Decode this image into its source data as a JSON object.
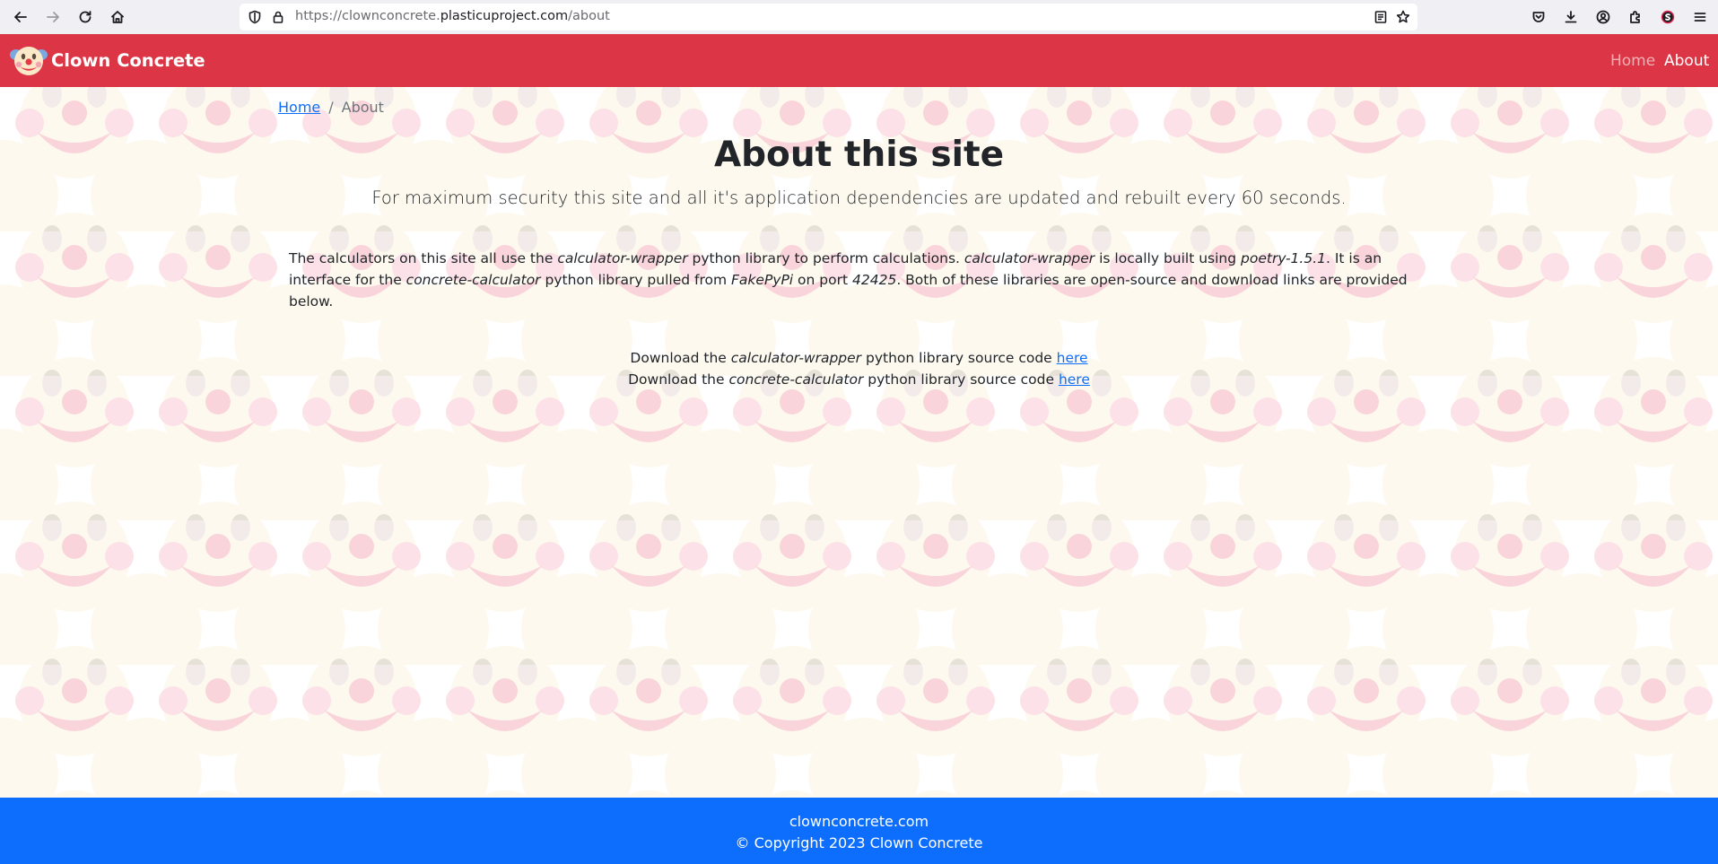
{
  "browser": {
    "url_prefix": "https://clownconcrete.",
    "url_domain": "plasticuproject.com",
    "url_path": "/about"
  },
  "header": {
    "brand": "Clown Concrete",
    "nav": [
      {
        "label": "Home",
        "active": false
      },
      {
        "label": "About",
        "active": true
      }
    ]
  },
  "breadcrumb": {
    "home": "Home",
    "separator": "/",
    "current": "About"
  },
  "main": {
    "title": "About this site",
    "lead": "For maximum security this site and all it's application dependencies are updated and rebuilt every 60 seconds.",
    "desc": {
      "p1": "The calculators on this site all use the ",
      "lib1": "calculator-wrapper",
      "p2": " python library to perform calculations. ",
      "lib1b": "calculator-wrapper",
      "p3": " is locally built using ",
      "poetry": "poetry-1.5.1",
      "p4": ". It is an interface for the ",
      "lib2": "concrete-calculator",
      "p5": " python library pulled from ",
      "repo": "FakePyPi",
      "p6": " on port ",
      "port": "42425",
      "p7": ". Both of these libraries are open-source and download links are provided below."
    },
    "downloads": [
      {
        "prefix": "Download the ",
        "lib": "calculator-wrapper",
        "suffix": " python library source code ",
        "link": "here"
      },
      {
        "prefix": "Download the ",
        "lib": "concrete-calculator",
        "suffix": " python library source code ",
        "link": "here"
      }
    ]
  },
  "footer": {
    "line1": "clownconcrete.com",
    "line2": "© Copyright 2023 Clown Concrete"
  },
  "colors": {
    "header_bg": "#dc3545",
    "footer_bg": "#0d6efd",
    "link": "#0d6efd"
  }
}
